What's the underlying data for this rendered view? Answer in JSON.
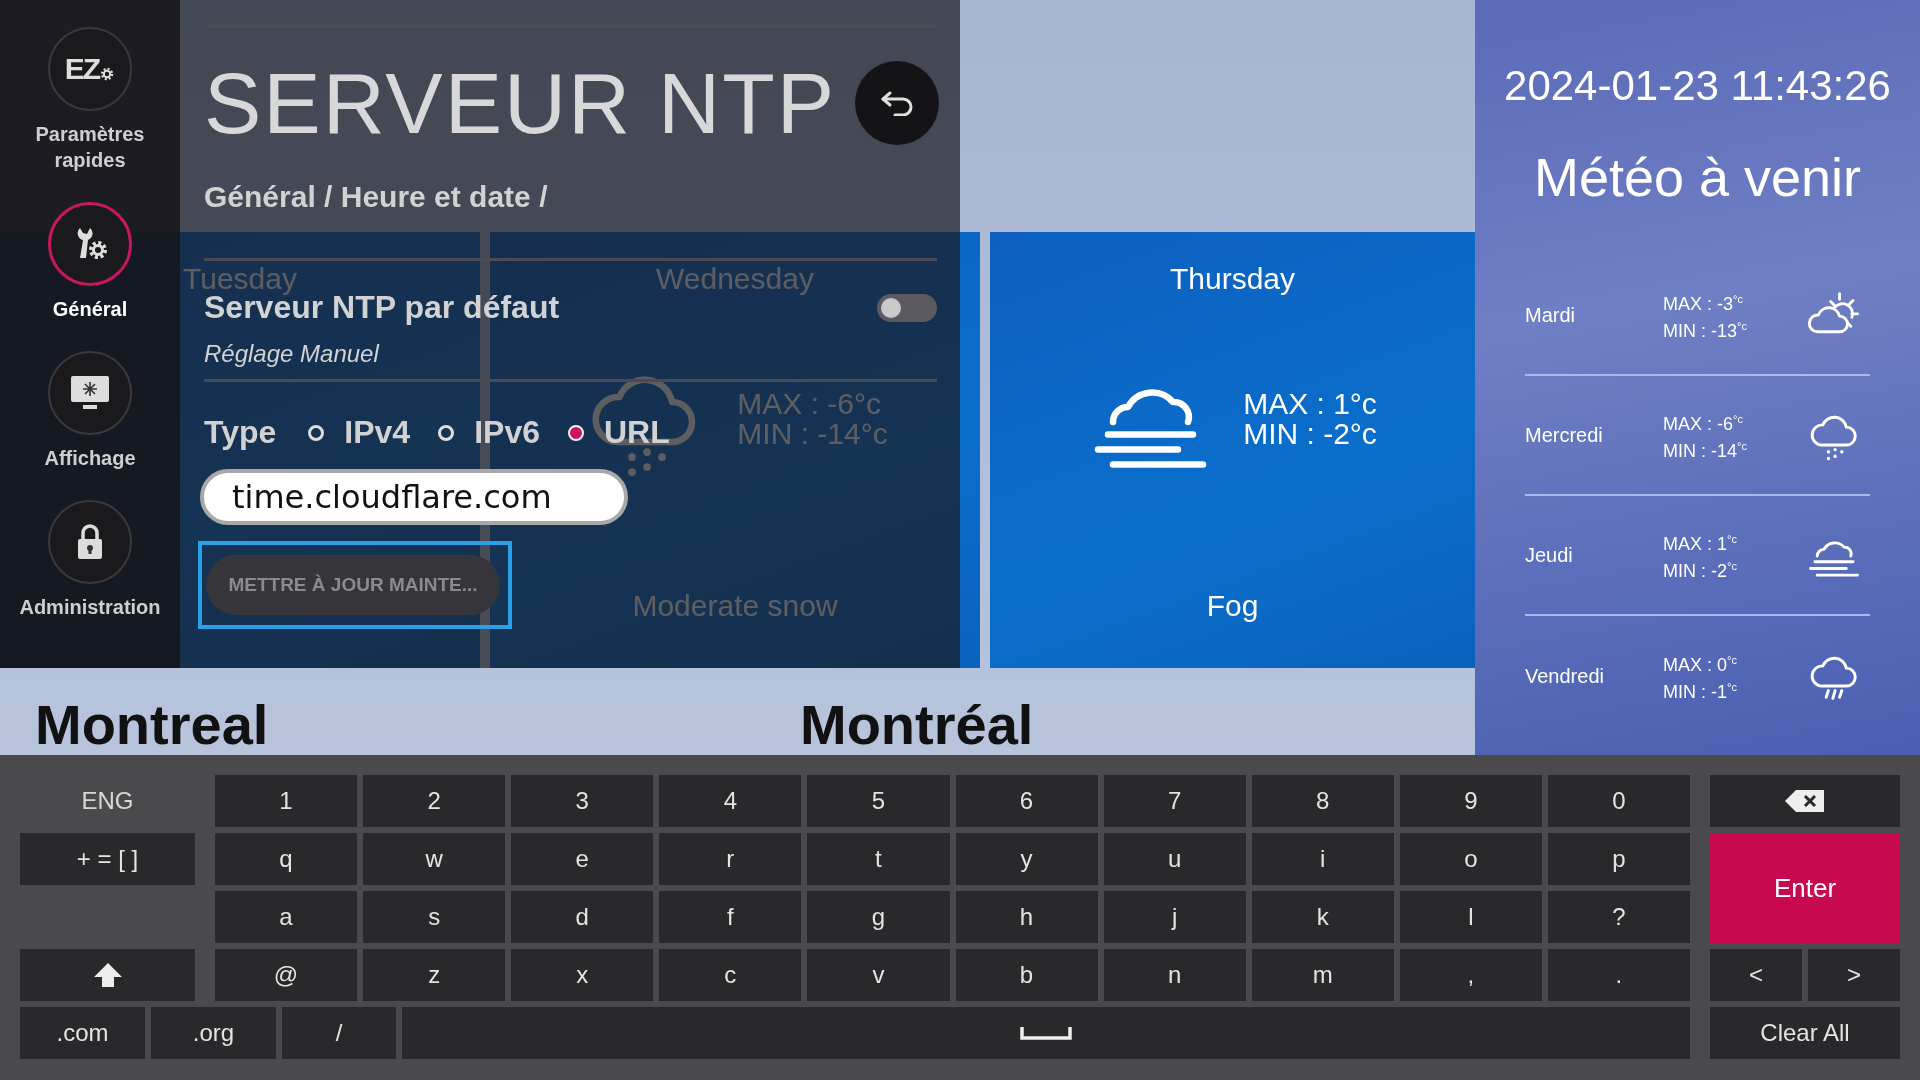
{
  "sidebar": {
    "items": [
      {
        "label": "Paramètres rapides",
        "kind": "quick",
        "badge": "EZ",
        "selected": false
      },
      {
        "label": "Général",
        "kind": "general",
        "selected": true
      },
      {
        "label": "Affichage",
        "kind": "display",
        "selected": false
      },
      {
        "label": "Administration",
        "kind": "lock",
        "selected": false
      }
    ]
  },
  "panel": {
    "title": "SERVEUR NTP",
    "breadcrumb": "Général / Heure et date /",
    "setting": {
      "label": "Serveur NTP par défaut",
      "on": false,
      "description": "Réglage Manuel"
    },
    "type": {
      "label": "Type",
      "options": [
        {
          "label": "IPv4",
          "selected": false
        },
        {
          "label": "IPv6",
          "selected": false
        },
        {
          "label": "URL",
          "selected": true
        }
      ]
    },
    "server_field": {
      "value": "time.cloudflare.com"
    },
    "update_button": {
      "label": "METTRE À JOUR MAINTE...",
      "focused": true,
      "disabled": true
    }
  },
  "weather_background": {
    "forecast_cards": [
      {
        "day": "Tuesday"
      },
      {
        "day": "Wednesday",
        "kind": "snow",
        "max": "MAX : -6°c",
        "min": "MIN : -14°c",
        "condition": "Moderate snow"
      },
      {
        "day": "Thursday",
        "kind": "fog",
        "max": "MAX : 1°c",
        "min": "MIN : -2°c",
        "condition": "Fog"
      }
    ],
    "cities": [
      "Montreal",
      "Montréal"
    ]
  },
  "upcoming": {
    "datetime": "2024-01-23 11:43:26",
    "title": "Météo à venir",
    "days": [
      {
        "day": "Mardi",
        "max": "MAX : -3$^{°c}$",
        "min": "MIN : -13$^{°c}$",
        "kind": "partly-cloudy"
      },
      {
        "day": "Mercredi",
        "max": "MAX : -6$^{°c}$",
        "min": "MIN : -14$^{°c}$",
        "kind": "snow"
      },
      {
        "day": "Jeudi",
        "max": "MAX : 1$^{°c}$",
        "min": "MIN : -2$^{°c}$",
        "kind": "fog"
      },
      {
        "day": "Vendredi",
        "max": "MAX : 0$^{°c}$",
        "min": "MIN : -1$^{°c}$",
        "kind": "rain"
      }
    ]
  },
  "keyboard": {
    "language": "ENG",
    "symbols_key": "+ = [ ]",
    "rows": [
      [
        "1",
        "2",
        "3",
        "4",
        "5",
        "6",
        "7",
        "8",
        "9",
        "0"
      ],
      [
        "q",
        "w",
        "e",
        "r",
        "t",
        "y",
        "u",
        "i",
        "o",
        "p"
      ],
      [
        "a",
        "s",
        "d",
        "f",
        "g",
        "h",
        "j",
        "k",
        "l",
        "?"
      ],
      [
        "@",
        "z",
        "x",
        "c",
        "v",
        "b",
        "n",
        "m",
        ",",
        "."
      ]
    ],
    "enter": "Enter",
    "left": "<",
    "right": ">",
    "shortcut_keys": [
      ".com",
      ".org",
      "/"
    ],
    "clear": "Clear All"
  }
}
